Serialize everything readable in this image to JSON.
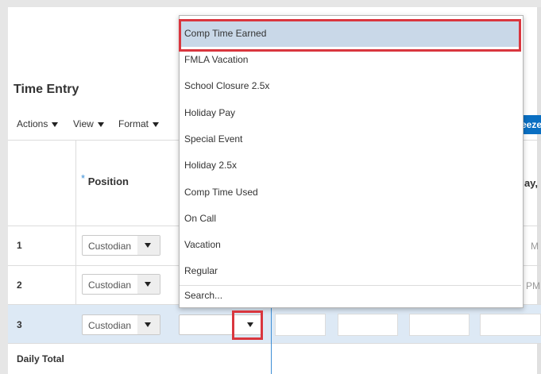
{
  "page": {
    "title": "Time Entry"
  },
  "toolbar": {
    "actions_label": "Actions",
    "view_label": "View",
    "format_label": "Format",
    "freeze_label": "Freeze"
  },
  "table": {
    "required_marker": "*",
    "position_header": "Position",
    "day_header_partial": "day,",
    "rows": [
      {
        "num": "1",
        "position": "Custodian",
        "time_partial": "M"
      },
      {
        "num": "2",
        "position": "Custodian",
        "time_partial": "PM"
      },
      {
        "num": "3",
        "position": "Custodian",
        "time_partial": ""
      }
    ],
    "total_label": "Daily Total"
  },
  "dropdown": {
    "selected_index": 0,
    "options": [
      "Comp Time Earned",
      "FMLA Vacation",
      "School Closure 2.5x",
      "Holiday Pay",
      "Special Event",
      "Holiday 2.5x",
      "Comp Time Used",
      "On Call",
      "Vacation",
      "Regular"
    ],
    "search_label": "Search..."
  },
  "colors": {
    "highlight": "#d9363e",
    "selected_row": "#dde9f5",
    "freeze_button": "#0a6fc2"
  }
}
